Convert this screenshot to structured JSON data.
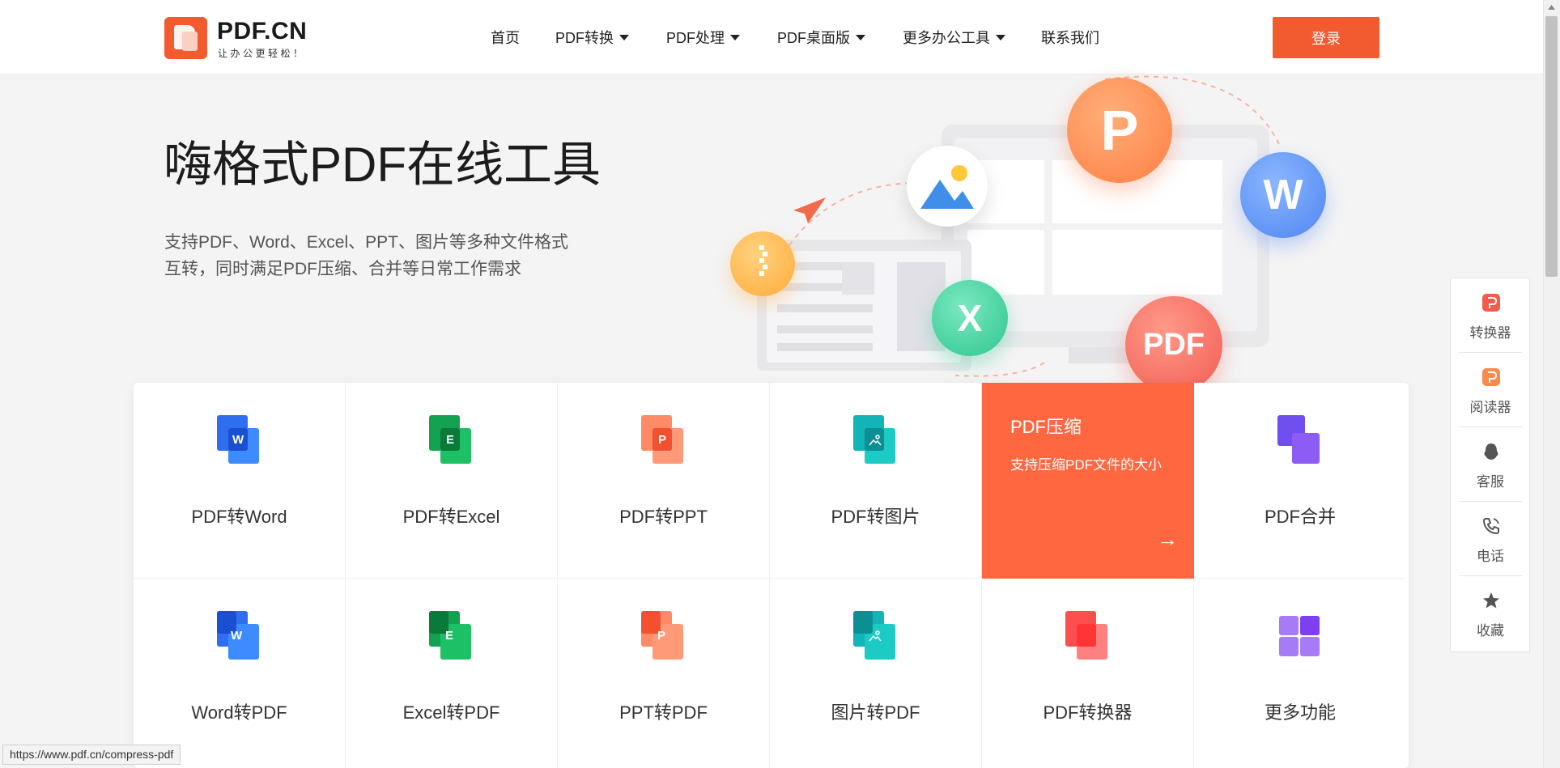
{
  "header": {
    "logo_title": "PDF.CN",
    "logo_slogan": "让办公更轻松！",
    "nav": [
      {
        "label": "首页",
        "dropdown": false
      },
      {
        "label": "PDF转换",
        "dropdown": true
      },
      {
        "label": "PDF处理",
        "dropdown": true
      },
      {
        "label": "PDF桌面版",
        "dropdown": true
      },
      {
        "label": "更多办公工具",
        "dropdown": true
      },
      {
        "label": "联系我们",
        "dropdown": false
      }
    ],
    "login_label": "登录"
  },
  "hero": {
    "title": "嗨格式PDF在线工具",
    "desc_line1": "支持PDF、Word、Excel、PPT、图片等多种文件格式",
    "desc_line2": "互转，同时满足PDF压缩、合并等日常工作需求"
  },
  "illustration": {
    "bubbles": [
      {
        "name": "ppt-bubble-icon",
        "text": "P",
        "color": "#ff8a4f"
      },
      {
        "name": "word-bubble-icon",
        "text": "W",
        "color": "#5b96f5"
      },
      {
        "name": "excel-bubble-icon",
        "text": "X",
        "color": "#3cd49f"
      },
      {
        "name": "pdf-bubble-icon",
        "text": "PDF",
        "color": "#f5665d"
      },
      {
        "name": "image-bubble-icon",
        "text": "",
        "color": "#ffffff"
      },
      {
        "name": "zip-bubble-icon",
        "text": "",
        "color": "#ffb64a"
      }
    ]
  },
  "tools": [
    {
      "label": "PDF转Word",
      "icon": "pdf-to-word-icon",
      "letter": "W",
      "color": "#2f6ef0",
      "back": "#3d8bff"
    },
    {
      "label": "PDF转Excel",
      "icon": "pdf-to-excel-icon",
      "letter": "E",
      "color": "#14a252",
      "back": "#1ec065"
    },
    {
      "label": "PDF转PPT",
      "icon": "pdf-to-ppt-icon",
      "letter": "P",
      "color": "#f2512f",
      "back": "#ff7a59"
    },
    {
      "label": "PDF转图片",
      "icon": "pdf-to-image-icon",
      "letter": "",
      "color": "#12b4b8",
      "back": "#1ccbc4"
    },
    {
      "label": "PDF压缩",
      "active": true,
      "desc": "支持压缩PDF文件的大小",
      "arrow": "→"
    },
    {
      "label": "PDF合并",
      "icon": "pdf-merge-icon",
      "letter": "",
      "color": "#7d4ff0",
      "back": "#8c5cf5"
    },
    {
      "label": "Word转PDF",
      "icon": "word-to-pdf-icon",
      "letter": "W",
      "color": "#2f6ef0",
      "back": "#3d8bff"
    },
    {
      "label": "Excel转PDF",
      "icon": "excel-to-pdf-icon",
      "letter": "E",
      "color": "#14a252",
      "back": "#1ec065"
    },
    {
      "label": "PPT转PDF",
      "icon": "ppt-to-pdf-icon",
      "letter": "P",
      "color": "#f2512f",
      "back": "#ff7a59"
    },
    {
      "label": "图片转PDF",
      "icon": "image-to-pdf-icon",
      "letter": "",
      "color": "#12b4b8",
      "back": "#1ccbc4"
    },
    {
      "label": "PDF转换器",
      "icon": "pdf-converter-icon",
      "letter": "",
      "color": "#ff4e4e",
      "back": "#ff8080"
    },
    {
      "label": "更多功能",
      "icon": "more-features-icon",
      "letter": "",
      "color": "#8b55f0",
      "back": "#a77bf5"
    }
  ],
  "floatbar": [
    {
      "label": "转换器",
      "icon": "converter-icon"
    },
    {
      "label": "阅读器",
      "icon": "reader-icon"
    },
    {
      "label": "客服",
      "icon": "customer-service-icon"
    },
    {
      "label": "电话",
      "icon": "phone-icon"
    },
    {
      "label": "收藏",
      "icon": "star-icon"
    }
  ],
  "status_url": "https://www.pdf.cn/compress-pdf"
}
